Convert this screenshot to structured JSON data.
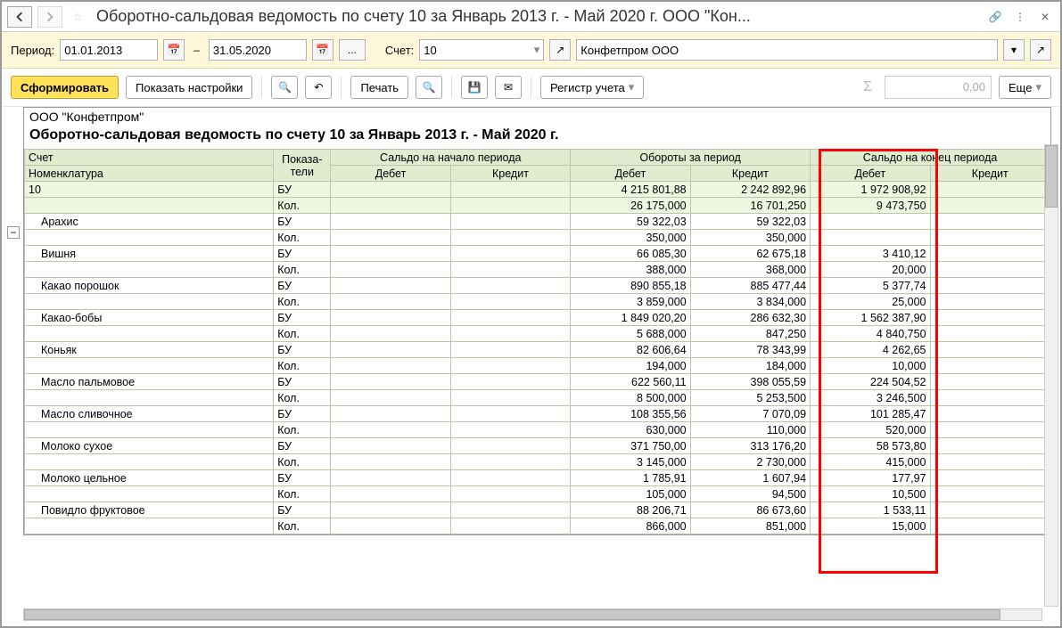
{
  "window": {
    "title": "Оборотно-сальдовая ведомость по счету 10 за Январь 2013 г. - Май 2020 г. ООО \"Кон..."
  },
  "params": {
    "period_label": "Период:",
    "date_from": "01.01.2013",
    "dash": "–",
    "date_to": "31.05.2020",
    "ellipsis": "...",
    "account_label": "Счет:",
    "account_value": "10",
    "org_value": "Конфетпром ООО"
  },
  "toolbar": {
    "form_btn": "Сформировать",
    "settings_btn": "Показать настройки",
    "print_btn": "Печать",
    "register_btn": "Регистр учета",
    "sum_display": "0,00",
    "more_btn": "Еще"
  },
  "report": {
    "org": "ООО \"Конфетпром\"",
    "title": "Оборотно-сальдовая ведомость по счету 10 за Январь 2013 г. - Май 2020 г.",
    "headers": {
      "acct": "Счет",
      "nomen": "Номенклатура",
      "indic": "Показа-\nтели",
      "open_bal": "Сальдо на начало периода",
      "turnover": "Обороты за период",
      "close_bal": "Сальдо на конец периода",
      "debit": "Дебет",
      "credit": "Кредит"
    },
    "rows": [
      {
        "name": "10",
        "ind": "БУ",
        "od": "",
        "oc": "",
        "td": "4 215 801,88",
        "tc": "2 242 892,96",
        "cd": "1 972 908,92",
        "cc": "",
        "total": true,
        "indent": false
      },
      {
        "name": "",
        "ind": "Кол.",
        "od": "",
        "oc": "",
        "td": "26 175,000",
        "tc": "16 701,250",
        "cd": "9 473,750",
        "cc": "",
        "total": true,
        "indent": false
      },
      {
        "name": "Арахис",
        "ind": "БУ",
        "od": "",
        "oc": "",
        "td": "59 322,03",
        "tc": "59 322,03",
        "cd": "",
        "cc": "",
        "indent": true
      },
      {
        "name": "",
        "ind": "Кол.",
        "od": "",
        "oc": "",
        "td": "350,000",
        "tc": "350,000",
        "cd": "",
        "cc": "",
        "indent": true
      },
      {
        "name": "Вишня",
        "ind": "БУ",
        "od": "",
        "oc": "",
        "td": "66 085,30",
        "tc": "62 675,18",
        "cd": "3 410,12",
        "cc": "",
        "indent": true
      },
      {
        "name": "",
        "ind": "Кол.",
        "od": "",
        "oc": "",
        "td": "388,000",
        "tc": "368,000",
        "cd": "20,000",
        "cc": "",
        "indent": true
      },
      {
        "name": "Какао порошок",
        "ind": "БУ",
        "od": "",
        "oc": "",
        "td": "890 855,18",
        "tc": "885 477,44",
        "cd": "5 377,74",
        "cc": "",
        "indent": true
      },
      {
        "name": "",
        "ind": "Кол.",
        "od": "",
        "oc": "",
        "td": "3 859,000",
        "tc": "3 834,000",
        "cd": "25,000",
        "cc": "",
        "indent": true
      },
      {
        "name": "Какао-бобы",
        "ind": "БУ",
        "od": "",
        "oc": "",
        "td": "1 849 020,20",
        "tc": "286 632,30",
        "cd": "1 562 387,90",
        "cc": "",
        "indent": true
      },
      {
        "name": "",
        "ind": "Кол.",
        "od": "",
        "oc": "",
        "td": "5 688,000",
        "tc": "847,250",
        "cd": "4 840,750",
        "cc": "",
        "indent": true
      },
      {
        "name": "Коньяк",
        "ind": "БУ",
        "od": "",
        "oc": "",
        "td": "82 606,64",
        "tc": "78 343,99",
        "cd": "4 262,65",
        "cc": "",
        "indent": true
      },
      {
        "name": "",
        "ind": "Кол.",
        "od": "",
        "oc": "",
        "td": "194,000",
        "tc": "184,000",
        "cd": "10,000",
        "cc": "",
        "indent": true
      },
      {
        "name": "Масло пальмовое",
        "ind": "БУ",
        "od": "",
        "oc": "",
        "td": "622 560,11",
        "tc": "398 055,59",
        "cd": "224 504,52",
        "cc": "",
        "indent": true
      },
      {
        "name": "",
        "ind": "Кол.",
        "od": "",
        "oc": "",
        "td": "8 500,000",
        "tc": "5 253,500",
        "cd": "3 246,500",
        "cc": "",
        "indent": true
      },
      {
        "name": "Масло сливочное",
        "ind": "БУ",
        "od": "",
        "oc": "",
        "td": "108 355,56",
        "tc": "7 070,09",
        "cd": "101 285,47",
        "cc": "",
        "indent": true
      },
      {
        "name": "",
        "ind": "Кол.",
        "od": "",
        "oc": "",
        "td": "630,000",
        "tc": "110,000",
        "cd": "520,000",
        "cc": "",
        "indent": true
      },
      {
        "name": "Молоко сухое",
        "ind": "БУ",
        "od": "",
        "oc": "",
        "td": "371 750,00",
        "tc": "313 176,20",
        "cd": "58 573,80",
        "cc": "",
        "indent": true
      },
      {
        "name": "",
        "ind": "Кол.",
        "od": "",
        "oc": "",
        "td": "3 145,000",
        "tc": "2 730,000",
        "cd": "415,000",
        "cc": "",
        "indent": true
      },
      {
        "name": "Молоко цельное",
        "ind": "БУ",
        "od": "",
        "oc": "",
        "td": "1 785,91",
        "tc": "1 607,94",
        "cd": "177,97",
        "cc": "",
        "indent": true
      },
      {
        "name": "",
        "ind": "Кол.",
        "od": "",
        "oc": "",
        "td": "105,000",
        "tc": "94,500",
        "cd": "10,500",
        "cc": "",
        "indent": true
      },
      {
        "name": "Повидло фруктовое",
        "ind": "БУ",
        "od": "",
        "oc": "",
        "td": "88 206,71",
        "tc": "86 673,60",
        "cd": "1 533,11",
        "cc": "",
        "indent": true
      },
      {
        "name": "",
        "ind": "Кол.",
        "od": "",
        "oc": "",
        "td": "866,000",
        "tc": "851,000",
        "cd": "15,000",
        "cc": "",
        "indent": true
      }
    ]
  }
}
